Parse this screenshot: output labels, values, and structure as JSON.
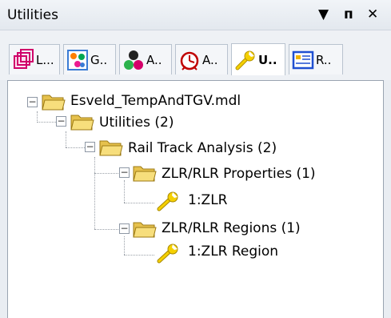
{
  "window": {
    "title": "Utilities",
    "controls": {
      "menu": "▼",
      "pin": "ᴨ",
      "close": "✕"
    }
  },
  "tabs": [
    {
      "label": "L...",
      "icon": "layers-icon",
      "active": false
    },
    {
      "label": "G..",
      "icon": "groups-icon",
      "active": false
    },
    {
      "label": "A..",
      "icon": "assemblies-icon",
      "active": false
    },
    {
      "label": "A..",
      "icon": "clock-icon",
      "active": false
    },
    {
      "label": "U..",
      "icon": "wrench-icon",
      "active": true
    },
    {
      "label": "R..",
      "icon": "results-icon",
      "active": false
    }
  ],
  "tree": {
    "model": "Esveld_TempAndTGV.mdl",
    "utilities": "Utilities (2)",
    "rail": "Rail Track Analysis (2)",
    "props": "ZLR/RLR Properties (1)",
    "prop_item": "1:ZLR",
    "regions": "ZLR/RLR Regions (1)",
    "region_item": "1:ZLR Region",
    "expander_symbol": "−"
  },
  "colors": {
    "folder": "#f0cf60",
    "wrench": "#f5d000",
    "panel_border": "#9aa4b1"
  }
}
